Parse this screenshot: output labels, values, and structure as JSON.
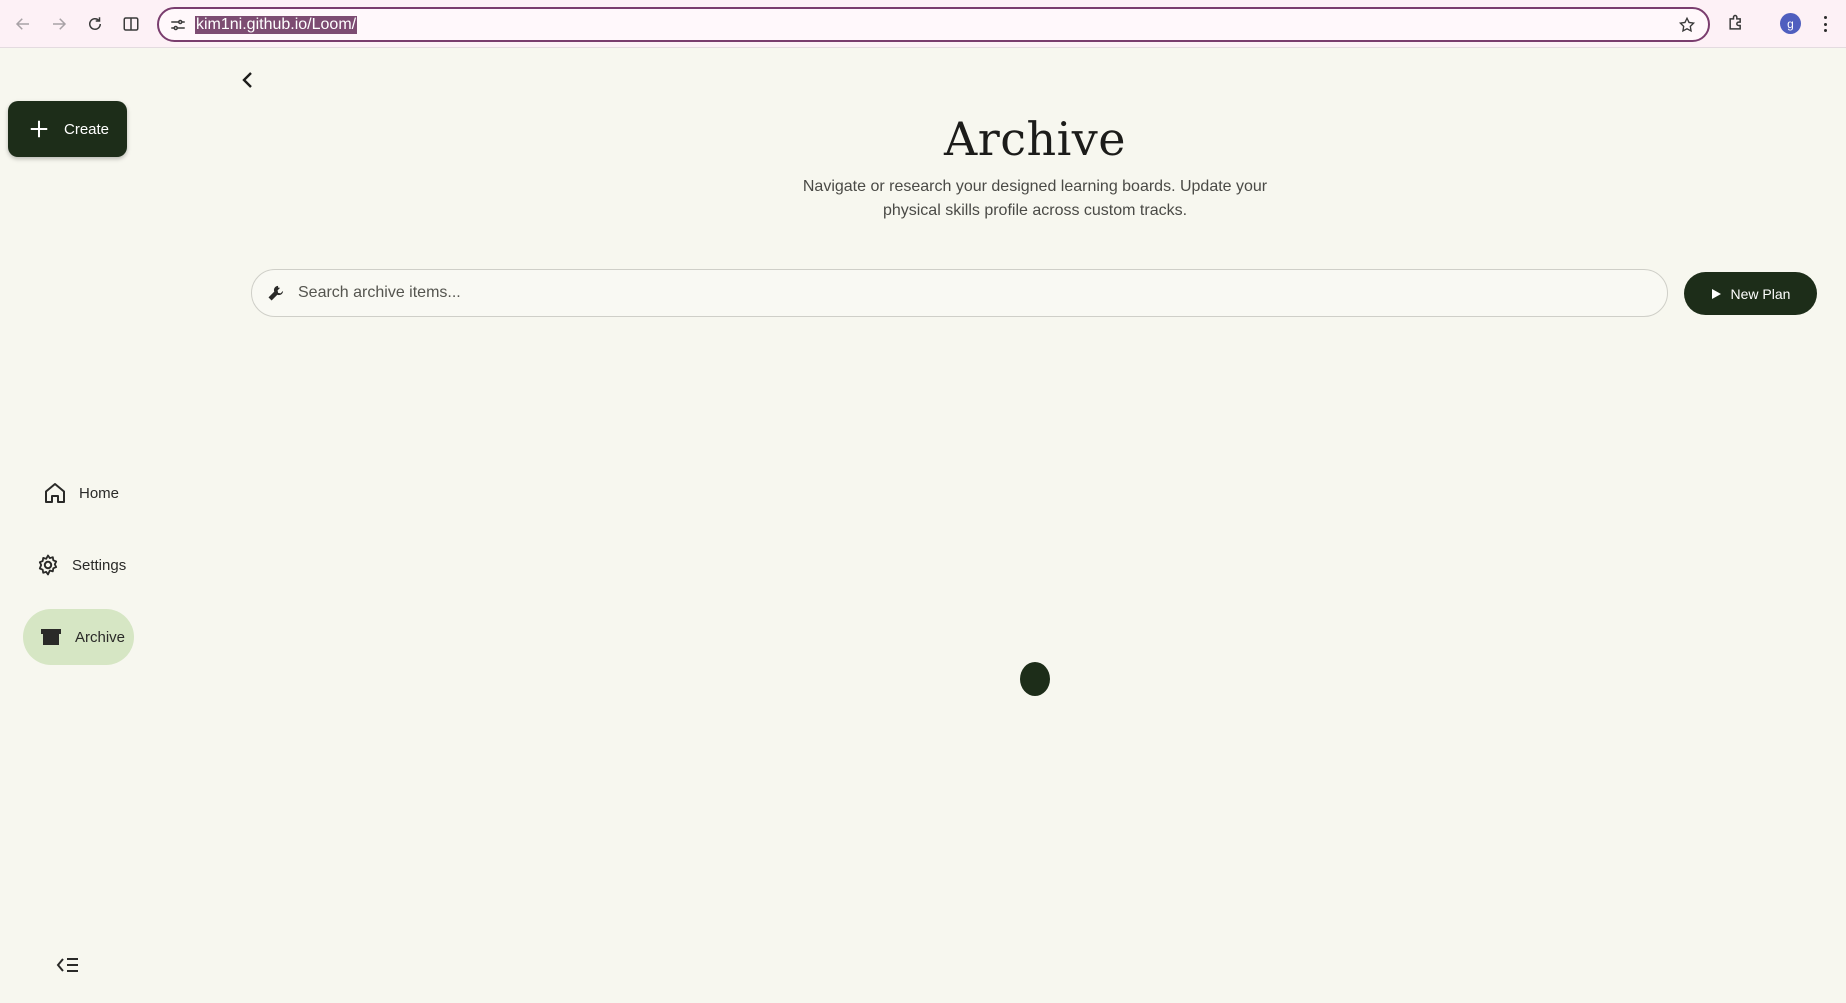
{
  "browser": {
    "url": "kim1ni.github.io/Loom/",
    "profile_initial": "g"
  },
  "sidebar": {
    "create_label": "Create",
    "items": [
      {
        "label": "Home",
        "icon": "home-icon"
      },
      {
        "label": "Settings",
        "icon": "gear-icon"
      },
      {
        "label": "Archive",
        "icon": "archive-icon",
        "active": true
      }
    ]
  },
  "main": {
    "title": "Archive",
    "subtitle": "Navigate or research your designed learning boards. Update your physical skills profile across custom tracks.",
    "search": {
      "placeholder": "Search archive items..."
    },
    "new_plan_label": "New Plan"
  },
  "colors": {
    "background": "#f7f7ef",
    "primary": "#1d2d19",
    "active_nav": "#d6e6c4",
    "chrome": "#fdf1f6"
  }
}
